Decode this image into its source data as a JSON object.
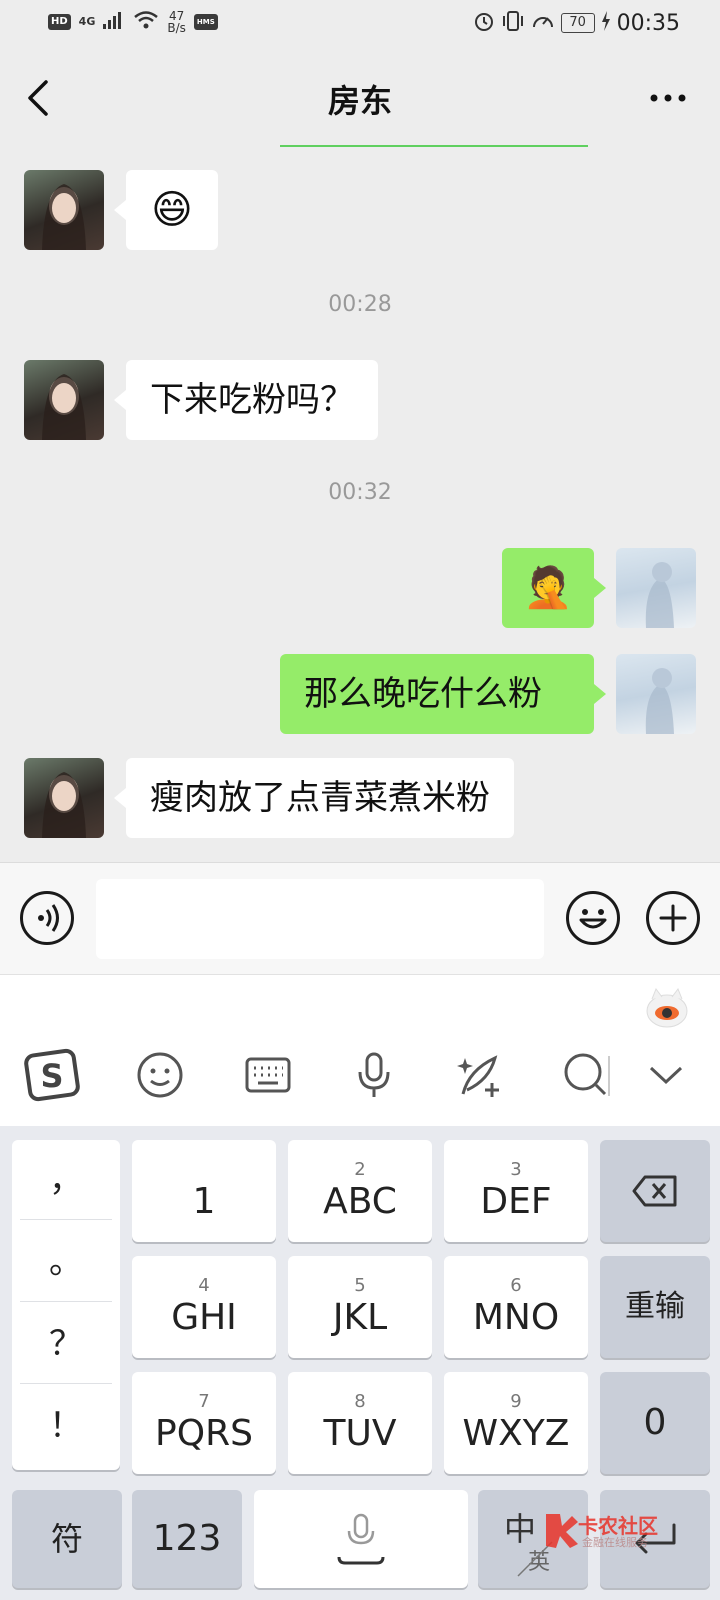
{
  "status_bar": {
    "hd": "HD",
    "network": "4G",
    "speed_value": "47",
    "speed_unit": "B/s",
    "hms": "HMS",
    "battery": "70",
    "time": "00:35"
  },
  "header": {
    "title": "房东"
  },
  "chat": {
    "messages": [
      {
        "side": "in",
        "type": "emoji",
        "text": "😄"
      },
      {
        "type": "time",
        "text": "00:28"
      },
      {
        "side": "in",
        "type": "text",
        "text": "下来吃粉吗？"
      },
      {
        "type": "time",
        "text": "00:32"
      },
      {
        "side": "out",
        "type": "emoji",
        "text": "🤦"
      },
      {
        "side": "out",
        "type": "text",
        "text": "那么晚吃什么粉"
      },
      {
        "side": "in",
        "type": "text",
        "text": "瘦肉放了点青菜煮米粉"
      }
    ]
  },
  "input": {
    "value": "",
    "voice_icon": "voice-icon",
    "emoji_icon": "emoji-icon",
    "plus_icon": "plus-icon"
  },
  "ime_toolbar": {
    "icons": [
      "sogou-logo-icon",
      "smile-icon",
      "keyboard-icon",
      "mic-icon",
      "handwriting-icon",
      "search-icon",
      "chevron-down-icon"
    ]
  },
  "keyboard": {
    "punctuation": [
      "，",
      "。",
      "？",
      "！"
    ],
    "keys": [
      {
        "num": "",
        "label": "1"
      },
      {
        "num": "2",
        "label": "ABC"
      },
      {
        "num": "3",
        "label": "DEF"
      },
      {
        "num": "4",
        "label": "GHI"
      },
      {
        "num": "5",
        "label": "JKL"
      },
      {
        "num": "6",
        "label": "MNO"
      },
      {
        "num": "7",
        "label": "PQRS"
      },
      {
        "num": "8",
        "label": "TUV"
      },
      {
        "num": "9",
        "label": "WXYZ"
      }
    ],
    "reinput": "重输",
    "zero": "0",
    "symbols": "符",
    "numbers": "123",
    "lang_zh": "中",
    "lang_en": "英"
  },
  "watermark": {
    "name": "卡农社区",
    "sub": "金融在线服务"
  },
  "colors": {
    "chat_bg": "#ededed",
    "out_bubble": "#95ec69",
    "in_bubble": "#ffffff",
    "accent_green": "#5fd05f"
  }
}
